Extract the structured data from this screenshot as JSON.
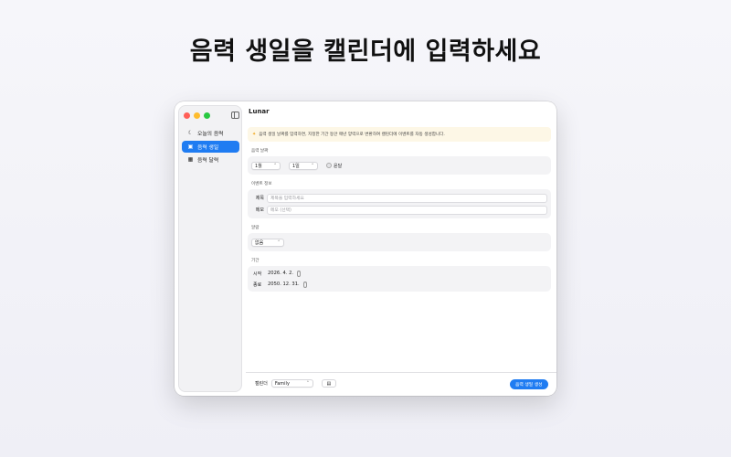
{
  "headline": "음력 생일을 캘린더에 입력하세요",
  "window": {
    "title": "Lunar"
  },
  "sidebar": {
    "items": [
      {
        "label": "오늘의 음력",
        "icon": "moon-icon",
        "active": false
      },
      {
        "label": "음력 생일",
        "icon": "gift-icon",
        "active": true
      },
      {
        "label": "음력 달력",
        "icon": "calendar-icon",
        "active": false
      }
    ]
  },
  "notice": "음력 생일 날짜를 입력하면, 지정한 기간 동안 매년 양력으로 변환하여 캘린더에 이벤트를 자동 생성합니다.",
  "lunar_date": {
    "label": "음력 날짜",
    "month": "1월",
    "day": "1일",
    "leap_label": "윤달"
  },
  "event_info": {
    "label": "이벤트 정보",
    "title_label": "제목",
    "title_placeholder": "제목을 입력하세요",
    "memo_label": "메모",
    "memo_placeholder": "메모 (선택)"
  },
  "alarm": {
    "label": "알람",
    "value": "없음"
  },
  "period": {
    "label": "기간",
    "start_label": "시작",
    "start_value": "2026.  4.  2.",
    "end_label": "종료",
    "end_value": "2050. 12. 31."
  },
  "footer": {
    "calendar_label": "캘린더",
    "calendar_value": "Family",
    "create_button": "음력 생일 생성"
  },
  "colors": {
    "accent": "#1f7cf2",
    "notice_bg": "#fdf7e6"
  }
}
